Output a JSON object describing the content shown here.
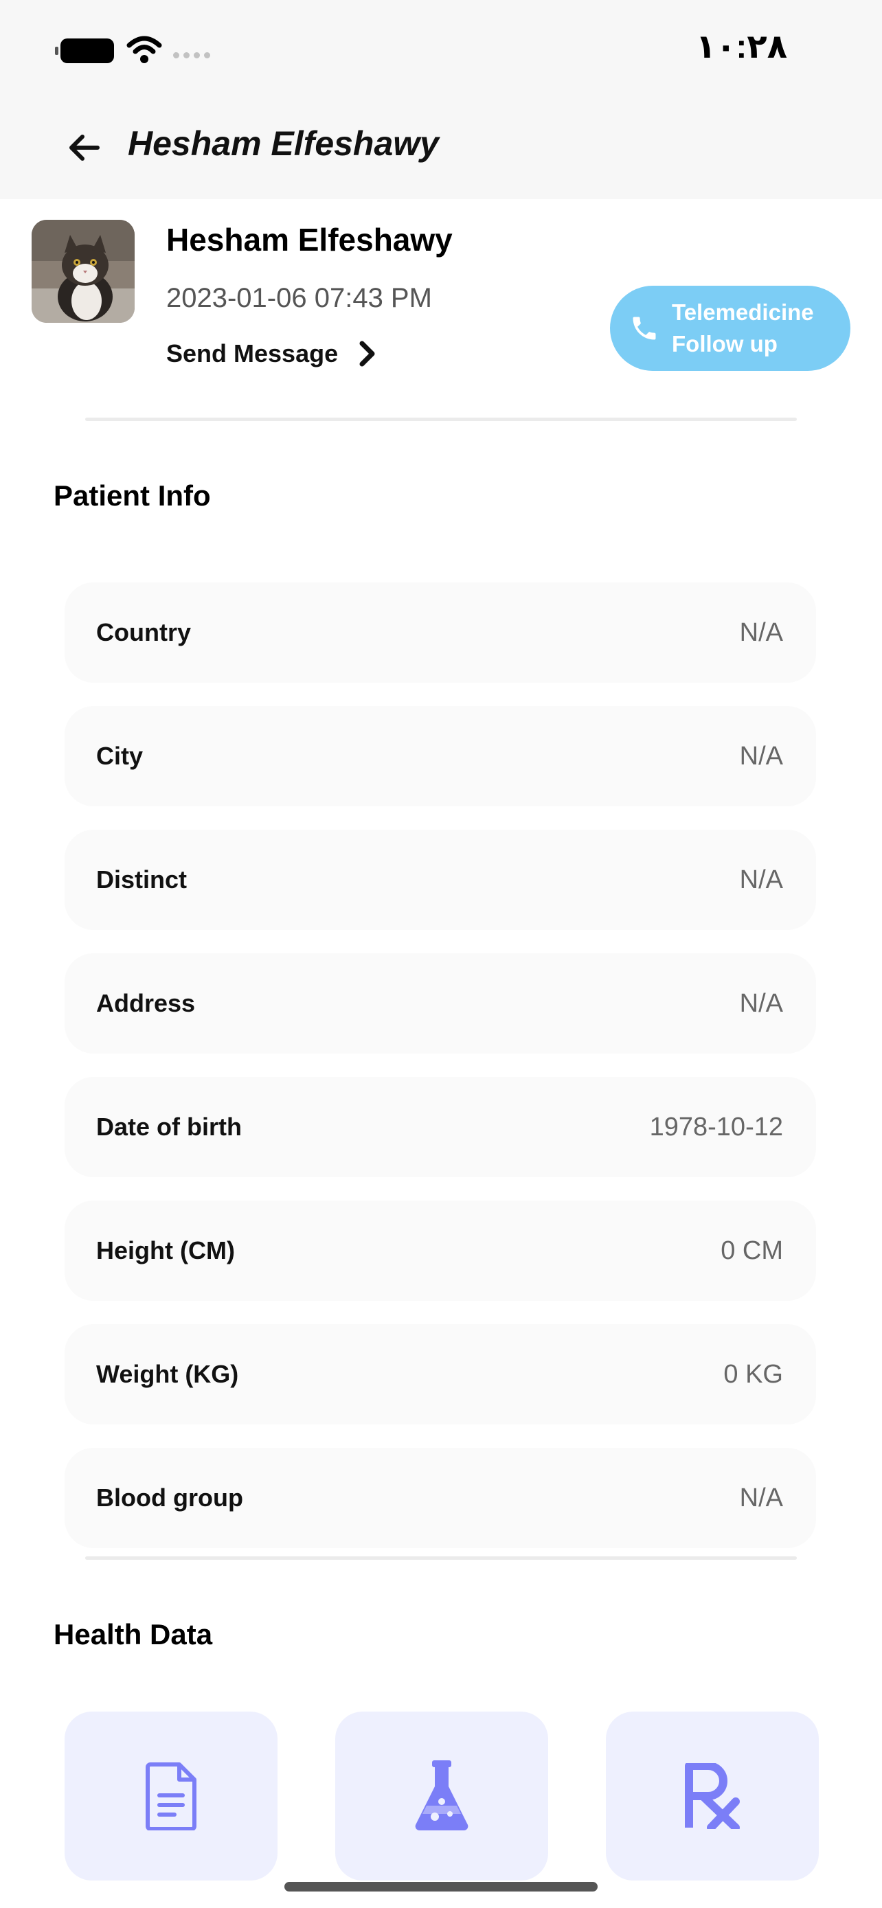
{
  "status_bar": {
    "time": "١٠:٢٨",
    "icons": [
      "battery-icon",
      "wifi-icon",
      "signal-icon"
    ]
  },
  "app_bar": {
    "title": "Hesham Elfeshawy",
    "back_icon": "arrow-left-icon"
  },
  "patient": {
    "name": "Hesham Elfeshawy",
    "datetime": "2023-01-06 07:43 PM",
    "send_message_label": "Send Message",
    "telemedicine_label": "Telemedicine\nFollow up",
    "avatar": "cat-photo"
  },
  "patient_info": {
    "title": "Patient Info",
    "rows": [
      {
        "label": "Country",
        "value": "N/A"
      },
      {
        "label": "City",
        "value": "N/A"
      },
      {
        "label": "Distinct",
        "value": "N/A"
      },
      {
        "label": "Address",
        "value": "N/A"
      },
      {
        "label": "Date of birth",
        "value": "1978-10-12"
      },
      {
        "label": "Height (CM)",
        "value": "0 CM"
      },
      {
        "label": "Weight (KG)",
        "value": "0 KG"
      },
      {
        "label": "Blood group",
        "value": "N/A"
      }
    ]
  },
  "health_data": {
    "title": "Health Data",
    "tiles": [
      {
        "icon": "document-icon"
      },
      {
        "icon": "lab-flask-icon"
      },
      {
        "icon": "prescription-icon"
      }
    ]
  },
  "colors": {
    "accent": "#7ccdf5",
    "tile_background": "#eef0fe",
    "icon_color": "#7b7ef7",
    "row_background": "#fafafa"
  }
}
